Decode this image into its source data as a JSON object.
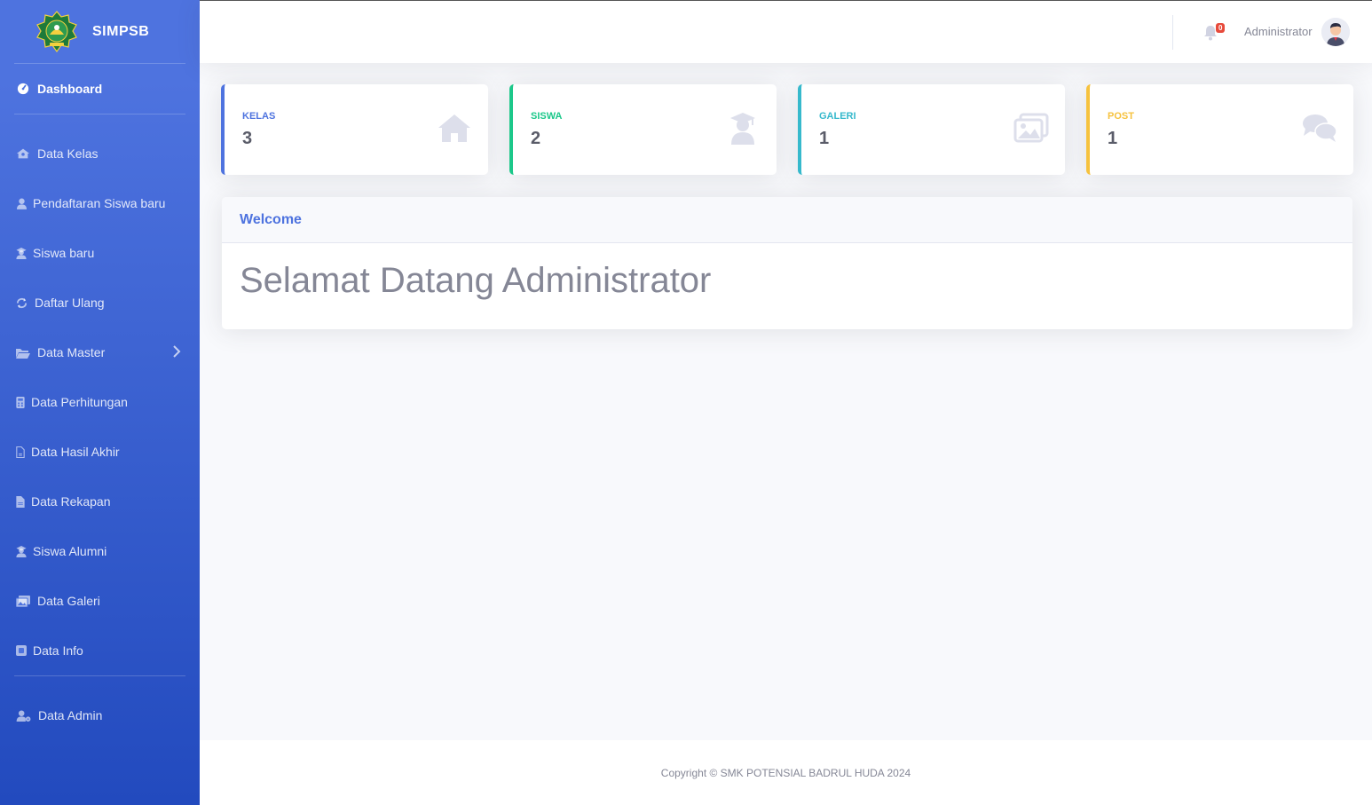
{
  "brand": {
    "name": "SIMPSB",
    "logo_icon": "school-emblem-icon"
  },
  "sidebar": {
    "dashboard": {
      "label": "Dashboard",
      "icon": "tachometer-icon"
    },
    "items": [
      {
        "label": "Data Kelas",
        "icon": "house-user-icon"
      },
      {
        "label": "Pendaftaran Siswa baru",
        "icon": "user-icon"
      },
      {
        "label": "Siswa baru",
        "icon": "user-graduate-icon"
      },
      {
        "label": "Daftar Ulang",
        "icon": "sync-icon"
      },
      {
        "label": "Data Master",
        "icon": "folder-open-icon"
      },
      {
        "label": "Data Perhitungan",
        "icon": "calculator-icon"
      },
      {
        "label": "Data Hasil Akhir",
        "icon": "file-icon"
      },
      {
        "label": "Data Rekapan",
        "icon": "file-alt-icon"
      },
      {
        "label": "Siswa Alumni",
        "icon": "user-graduate-icon"
      },
      {
        "label": "Data Galeri",
        "icon": "images-icon"
      },
      {
        "label": "Data Info",
        "icon": "info-square-icon"
      }
    ],
    "admin": {
      "label": "Data Admin",
      "icon": "user-cog-icon"
    }
  },
  "topbar": {
    "notification_count": "0",
    "user_name": "Administrator"
  },
  "stats": [
    {
      "label": "KELAS",
      "value": "3",
      "color": "#4e73df",
      "icon": "home-icon"
    },
    {
      "label": "SISWA",
      "value": "2",
      "color": "#1cc88a",
      "icon": "user-graduate-icon"
    },
    {
      "label": "GALERI",
      "value": "1",
      "color": "#36b9cc",
      "icon": "images-icon"
    },
    {
      "label": "POST",
      "value": "1",
      "color": "#f6c23e",
      "icon": "comments-icon"
    }
  ],
  "welcome": {
    "header": "Welcome",
    "message": "Selamat Datang Administrator"
  },
  "footer": {
    "copyright": "Copyright © SMK POTENSIAL BADRUL HUDA 2024"
  }
}
